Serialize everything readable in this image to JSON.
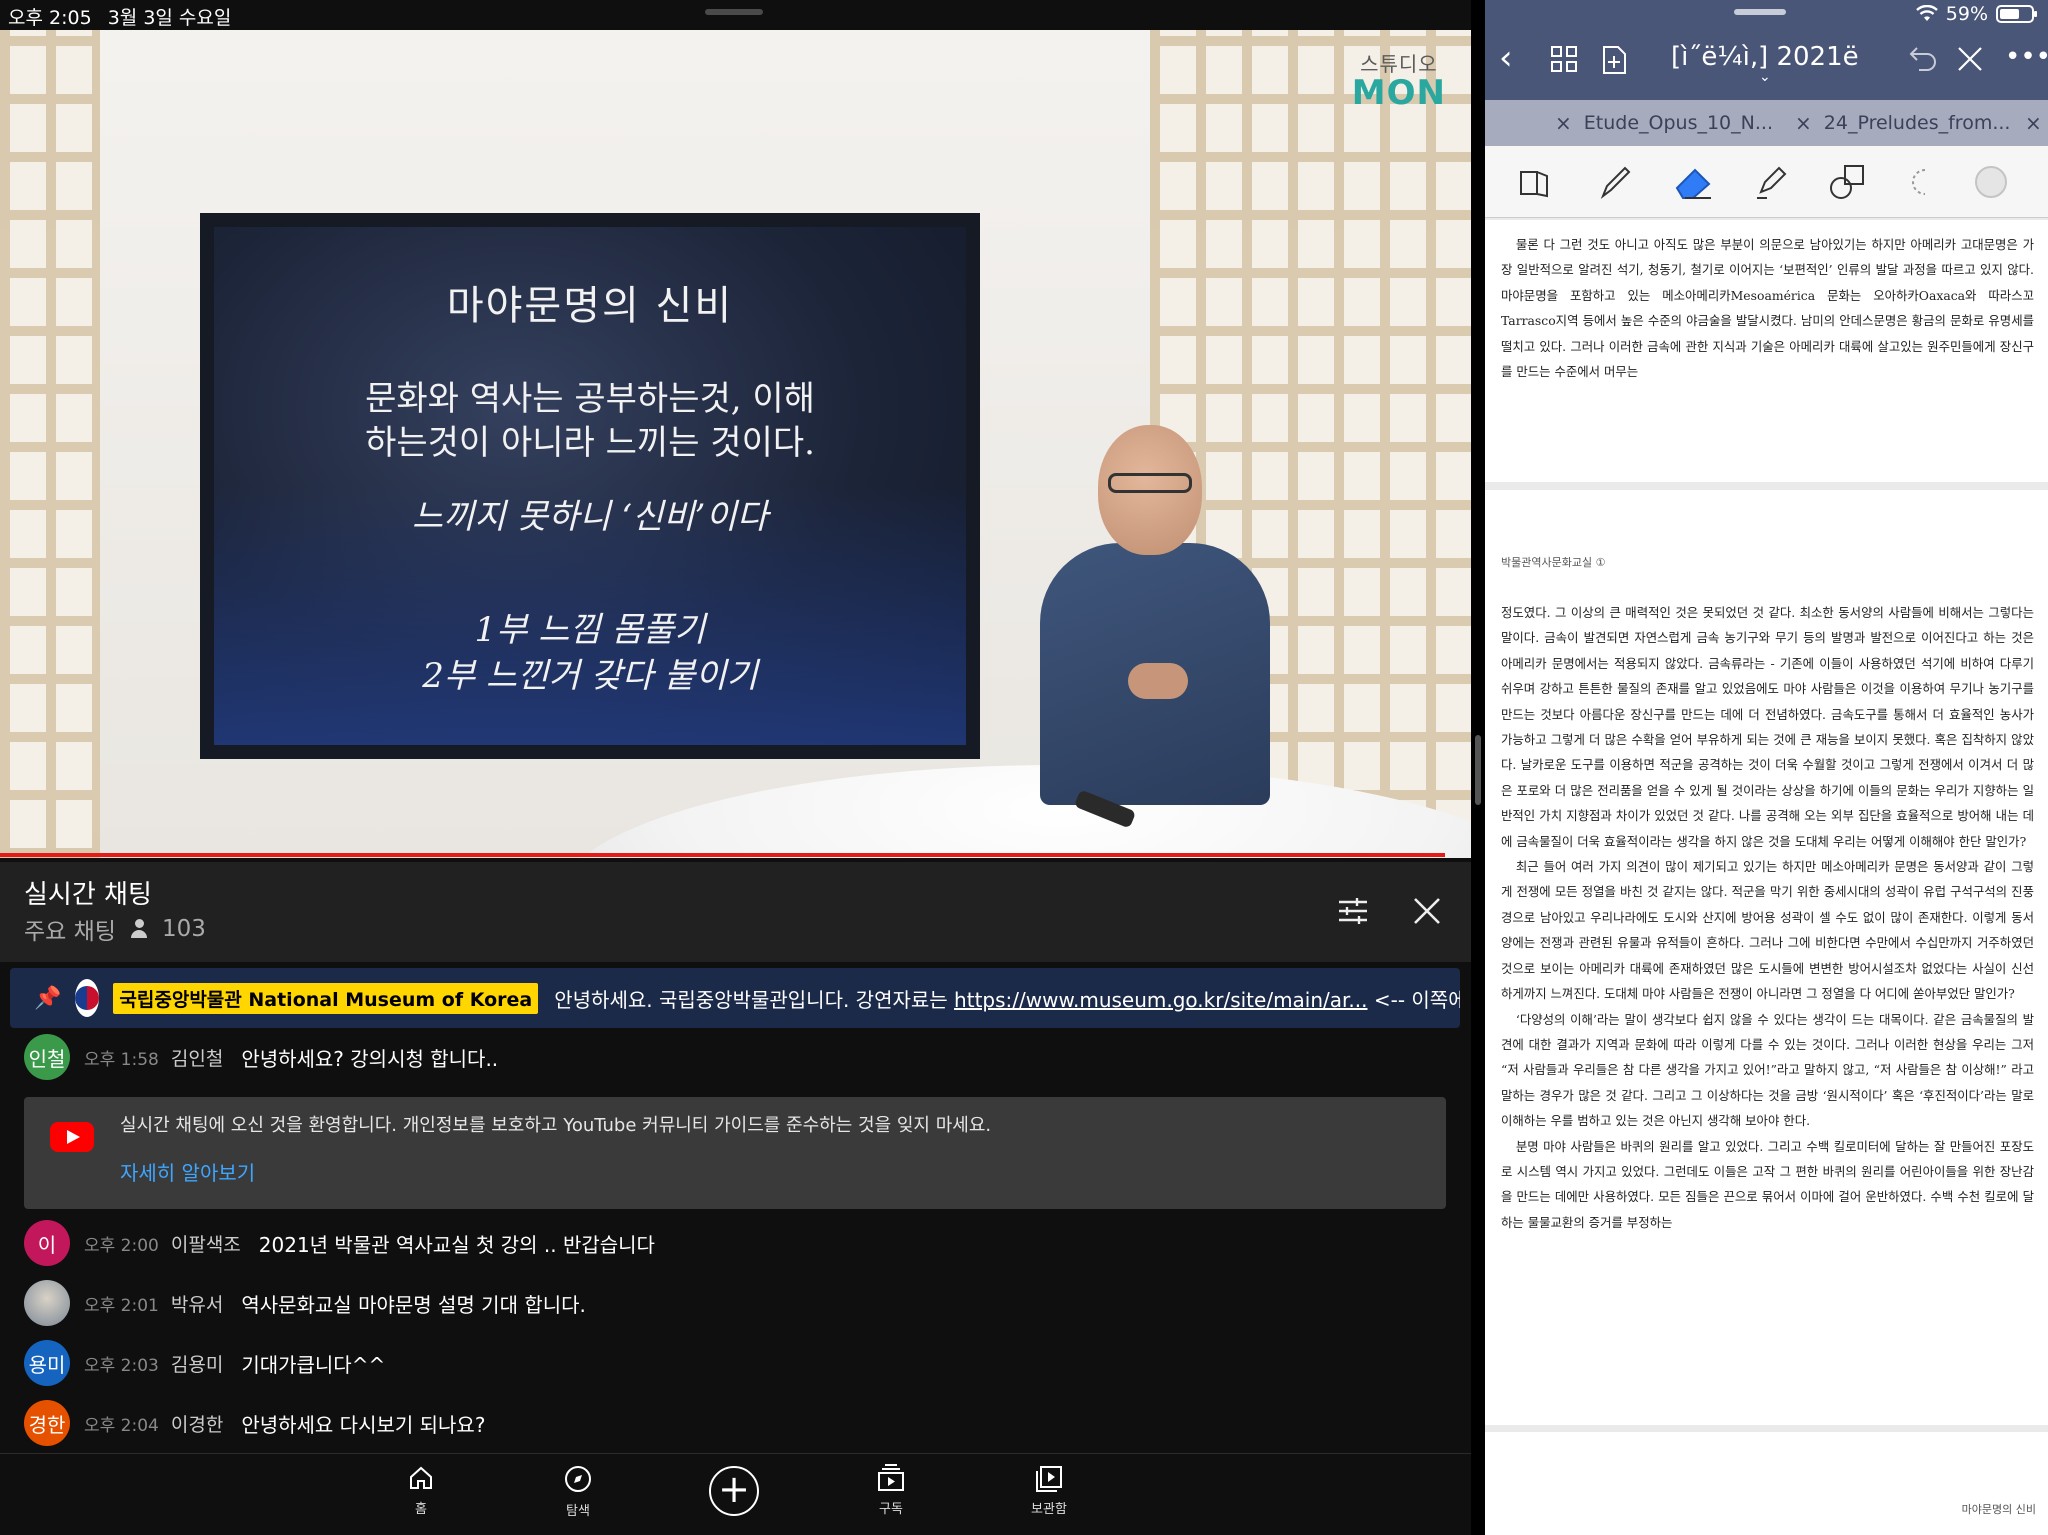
{
  "status_bar": {
    "time": "오후 2:05",
    "date": "3월 3일 수요일",
    "battery": "59%"
  },
  "video": {
    "logo_small": "스튜디오",
    "logo_big": "MON",
    "slide": {
      "title": "마야문명의 신비",
      "line1": "문화와 역사는 공부하는것, 이해",
      "line2": "하는것이 아니라 느끼는 것이다.",
      "line3": "느끼지 못하니 ‘신비’이다",
      "line4": "1부 느낌 몸풀기",
      "line5": "2부 느낀거 갖다 붙이기"
    }
  },
  "chat": {
    "title": "실시간 채팅",
    "mode": "주요 채팅",
    "viewer_count": "103",
    "pinned": {
      "owner": "국립중앙박물관 National Museum of Korea",
      "text": "안녕하세요. 국립중앙박물관입니다. 강연자료는",
      "link": "https://www.museum.go.kr/site/main/ar...",
      "after": "<-- 이쪽에 접속하…"
    },
    "notice": {
      "text": "실시간 채팅에 오신 것을 환영합니다. 개인정보를 보호하고 YouTube 커뮤니티 가이드를 준수하는 것을 잊지 마세요.",
      "link": "자세히 알아보기"
    },
    "messages": [
      {
        "avatar": "인철",
        "color": "#3a9a4a",
        "time": "오후 1:58",
        "author": "김인철",
        "text": "안녕하세요? 강의시청 합니다.."
      },
      {
        "avatar": "이",
        "color": "#c2185b",
        "time": "오후 2:00",
        "author": "이팔색조",
        "text": "2021년 박물관 역사교실 첫 강의 .. 반갑습니다"
      },
      {
        "avatar": "",
        "color": "#8a9aa8",
        "time": "오후 2:01",
        "author": "박유서",
        "text": "역사문화교실 마야문명 설명 기대 합니다."
      },
      {
        "avatar": "용미",
        "color": "#1565c0",
        "time": "오후 2:03",
        "author": "김용미",
        "text": "기대가큽니다^^"
      },
      {
        "avatar": "경한",
        "color": "#e65100",
        "time": "오후 2:04",
        "author": "이경한",
        "text": "안녕하세요 다시보기 되나요?"
      }
    ]
  },
  "bottom_nav": {
    "home": "홈",
    "explore": "탐색",
    "subscriptions": "구독",
    "library": "보관함"
  },
  "notes_app": {
    "title": "[ì˝ë¼ì‚] 2021ë",
    "tabs": [
      "Etude_Opus_10_N...",
      "24_Preludes_from..."
    ],
    "page1_text": "물론 다 그런 것도 아니고 아직도 많은 부분이 의문으로 남아있기는 하지만 아메리카 고대문명은 가장 일반적으로 알려진 석기, 청동기, 철기로 이어지는 ‘보편적인’ 인류의 발달 과정을 따르고 있지 않다. 마야문명을 포함하고 있는 메소아메리카Mesoamérica 문화는 오아하카Oaxaca와 따라스꼬Tarrasco지역 등에서 높은 수준의 야금술을 발달시켰다. 남미의 안데스문명은 황금의 문화로 유명세를 떨치고 있다. 그러나 이러한 금속에 관한 지식과 기술은 아메리카 대륙에 살고있는 원주민들에게 장신구를 만드는 수준에서 머무는",
    "page2_header": "박물관역사문화교실 ①",
    "page2_p1": "정도였다. 그 이상의 큰 매력적인 것은 못되었던 것 같다. 최소한 동서양의 사람들에 비해서는 그렇다는 말이다. 금속이 발견되면 자연스럽게 금속 농기구와 무기 등의 발명과 발전으로 이어진다고 하는 것은 아메리카 문명에서는 적용되지 않았다. 금속류라는 - 기존에 이들이 사용하였던 석기에 비하여 다루기 쉬우며 강하고 튼튼한 물질의 존재를 알고 있었음에도 마야 사람들은 이것을 이용하여 무기나 농기구를 만드는 것보다 아름다운 장신구를 만드는 데에 더 전념하였다. 금속도구를 통해서 더 효율적인 농사가 가능하고 그렇게 더 많은 수확을 얻어 부유하게 되는 것에 큰 재능을 보이지 못했다. 혹은 집착하지 않았다. 날카로운 도구를 이용하면 적군을 공격하는 것이 더욱 수월할 것이고 그렇게 전쟁에서 이겨서 더 많은 포로와 더 많은 전리품을 얻을 수 있게 될 것이라는 상상을 하기에 이들의 문화는 우리가 지향하는 일반적인 가치 지향점과 차이가 있었던 것 같다. 나를 공격해 오는 외부 집단을 효율적으로 방어해 내는 데에 금속물질이 더욱 효율적이라는 생각을 하지 않은 것을 도대체 우리는 어떻게 이해해야 한단 말인가?",
    "page2_p2": "최근 들어 여러 가지 의견이 많이 제기되고 있기는 하지만 메소아메리카 문명은 동서양과 같이 그렇게 전쟁에 모든 정열을 바친 것 같지는 않다. 적군을 막기 위한 중세시대의 성곽이 유럽 구석구석의 진풍경으로 남아있고 우리나라에도 도시와 산지에 방어용 성곽이 셀 수도 없이 많이 존재한다. 이렇게 동서양에는 전쟁과 관련된 유물과 유적들이 흔하다. 그러나 그에 비한다면 수만에서 수십만까지 거주하였던 것으로 보이는 아메리카 대륙에 존재하였던 많은 도시들에 변변한 방어시설조차 없었다는 사실이 신선하게까지 느껴진다. 도대체 마야 사람들은 전쟁이 아니라면 그 정열을 다 어디에 쏟아부었단 말인가?",
    "page2_p3": "‘다양성의 이해’라는 말이 생각보다 쉽지 않을 수 있다는 생각이 드는 대목이다. 같은 금속물질의 발견에 대한 결과가 지역과 문화에 따라 이렇게 다를 수 있는 것이다. 그러나 이러한 현상을 우리는 그저 “저 사람들과 우리들은 참 다른 생각을 가지고 있어!”라고 말하지 않고, “저 사람들은 참 이상해!” 라고 말하는 경우가 많은 것 같다. 그리고 그 이상하다는 것을 금방 ‘원시적이다’ 혹은 ‘후진적이다’라는 말로 이해하는 우를 범하고 있는 것은 아닌지 생각해 보아야 한다.",
    "page2_p4": "분명 마야 사람들은 바퀴의 원리를 알고 있었다. 그리고 수백 킬로미터에 달하는 잘 만들어진 포장도로 시스템 역시 가지고 있었다. 그런데도 이들은 고작 그 편한 바퀴의 원리를 어린아이들을 위한 장난감을 만드는 데에만 사용하였다. 모든 짐들은 끈으로 묶어서 이마에 걸어 운반하였다. 수백 수천 킬로에 달하는 물물교환의 증거를 부정하는",
    "page2_footer": "마야문명의 신비"
  }
}
